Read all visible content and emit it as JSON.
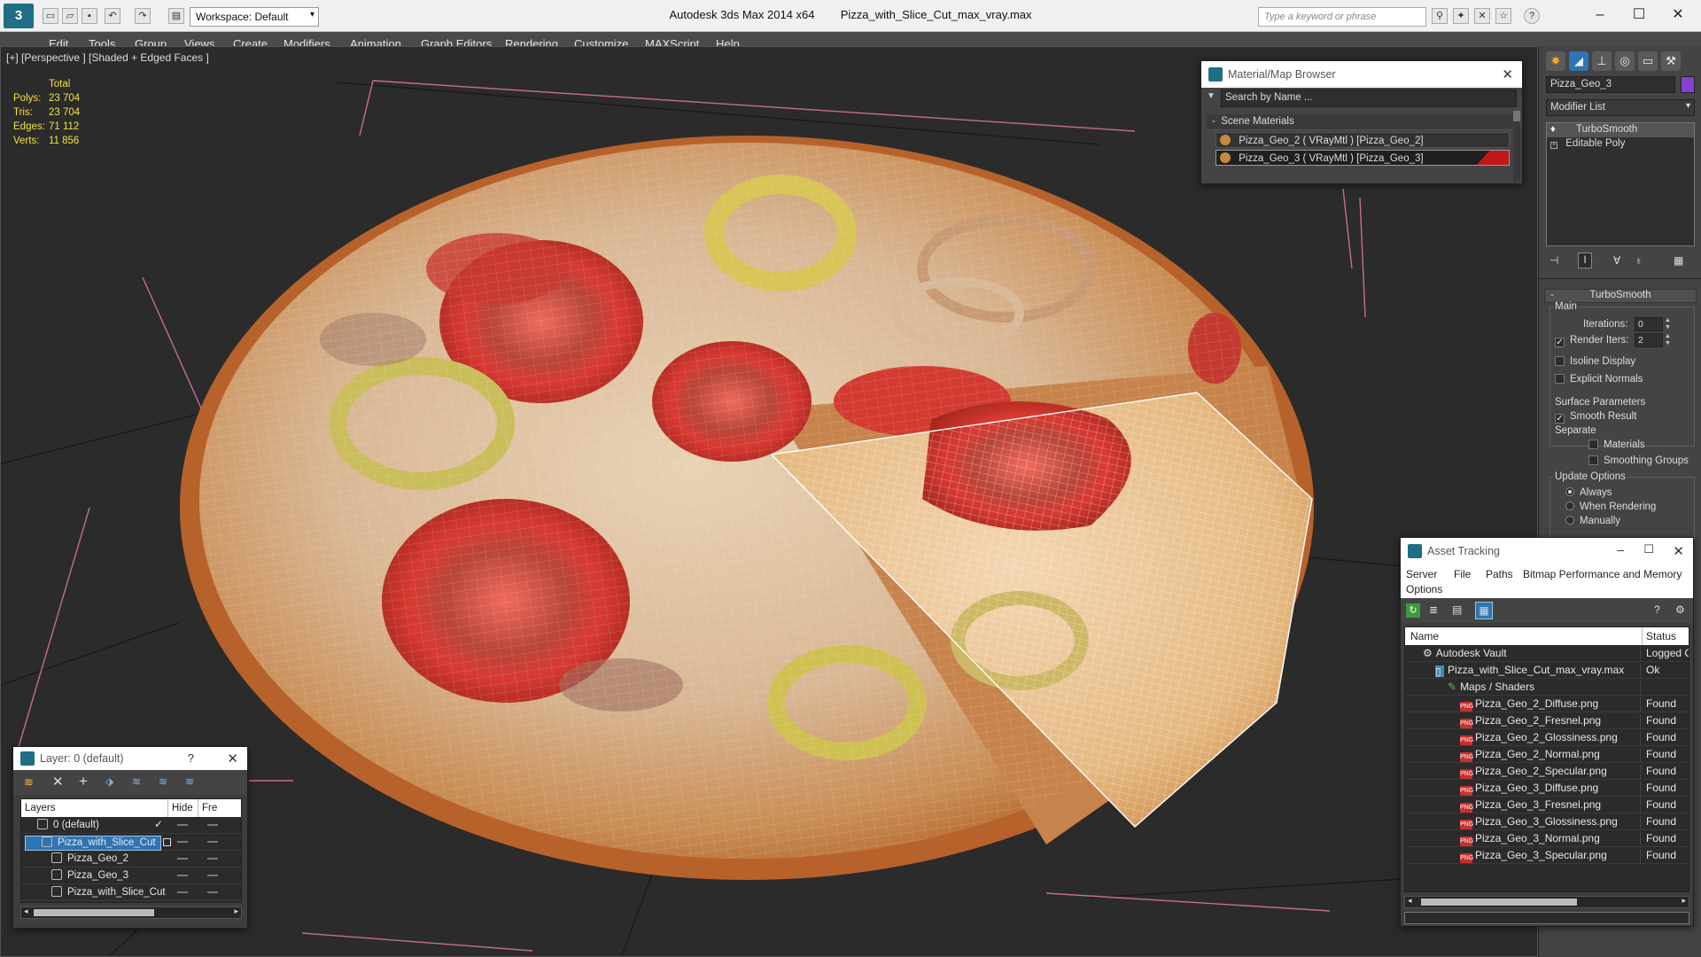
{
  "titlebar": {
    "app_title": "Autodesk 3ds Max  2014 x64",
    "file_title": "Pizza_with_Slice_Cut_max_vray.max",
    "workspace": "Workspace: Default",
    "search_placeholder": "Type a keyword or phrase"
  },
  "menu": [
    "Edit",
    "Tools",
    "Group",
    "Views",
    "Create",
    "Modifiers",
    "Animation",
    "Graph Editors",
    "Rendering",
    "Customize",
    "MAXScript",
    "Help"
  ],
  "viewport": {
    "label": "[+] [Perspective ] [Shaded + Edged Faces ]",
    "stats_header": "Total",
    "stats": [
      {
        "k": "Polys:",
        "v": "23 704"
      },
      {
        "k": "Tris:",
        "v": "23 704"
      },
      {
        "k": "Edges:",
        "v": "71 112"
      },
      {
        "k": "Verts:",
        "v": "11 856"
      }
    ]
  },
  "material_browser": {
    "title": "Material/Map Browser",
    "search_placeholder": "Search by Name ...",
    "section": "Scene Materials",
    "items": [
      {
        "label": "Pizza_Geo_2  ( VRayMtl )  [Pizza_Geo_2]",
        "color": "#3b3b3b"
      },
      {
        "label": "Pizza_Geo_3  ( VRayMtl )  [Pizza_Geo_3]",
        "color": "#c01818"
      }
    ]
  },
  "command_panel": {
    "object_name": "Pizza_Geo_3",
    "object_color": "#8a3fd0",
    "modifier_list": "Modifier List",
    "stack": [
      "TurboSmooth",
      "Editable Poly"
    ],
    "rollout_title": "TurboSmooth",
    "main_label": "Main",
    "iterations_label": "Iterations:",
    "iterations_value": "0",
    "render_iters_label": "Render Iters:",
    "render_iters_value": "2",
    "isoline": "Isoline Display",
    "explicit_normals": "Explicit Normals",
    "surface_params": "Surface Parameters",
    "smooth_result": "Smooth Result",
    "separate": "Separate",
    "materials": "Materials",
    "smoothing_groups": "Smoothing Groups",
    "update_options": "Update Options",
    "always": "Always",
    "when_rendering": "When Rendering",
    "manually": "Manually"
  },
  "layer_panel": {
    "title": "Layer: 0 (default)",
    "help": "?",
    "col_layers": "Layers",
    "col_hide": "Hide",
    "col_freeze": "Fre",
    "rows": [
      {
        "name": "0 (default)",
        "indent": 0
      },
      {
        "name": "Pizza_with_Slice_Cut",
        "indent": 0
      },
      {
        "name": "Pizza_Geo_2",
        "indent": 1
      },
      {
        "name": "Pizza_Geo_3",
        "indent": 1
      },
      {
        "name": "Pizza_with_Slice_Cut",
        "indent": 1
      }
    ]
  },
  "asset_tracking": {
    "title": "Asset Tracking",
    "menu": [
      "Server",
      "File",
      "Paths",
      "Bitmap Performance and Memory",
      "Options"
    ],
    "col_name": "Name",
    "col_status": "Status",
    "rows": [
      {
        "name": "Autodesk Vault",
        "status": "Logged C",
        "indent": 1,
        "type": "vault"
      },
      {
        "name": "Pizza_with_Slice_Cut_max_vray.max",
        "status": "Ok",
        "indent": 2,
        "type": "max"
      },
      {
        "name": "Maps / Shaders",
        "status": "",
        "indent": 3,
        "type": "maps"
      },
      {
        "name": "Pizza_Geo_2_Diffuse.png",
        "status": "Found",
        "indent": 4,
        "type": "png"
      },
      {
        "name": "Pizza_Geo_2_Fresnel.png",
        "status": "Found",
        "indent": 4,
        "type": "png"
      },
      {
        "name": "Pizza_Geo_2_Glossiness.png",
        "status": "Found",
        "indent": 4,
        "type": "png"
      },
      {
        "name": "Pizza_Geo_2_Normal.png",
        "status": "Found",
        "indent": 4,
        "type": "png"
      },
      {
        "name": "Pizza_Geo_2_Specular.png",
        "status": "Found",
        "indent": 4,
        "type": "png"
      },
      {
        "name": "Pizza_Geo_3_Diffuse.png",
        "status": "Found",
        "indent": 4,
        "type": "png"
      },
      {
        "name": "Pizza_Geo_3_Fresnel.png",
        "status": "Found",
        "indent": 4,
        "type": "png"
      },
      {
        "name": "Pizza_Geo_3_Glossiness.png",
        "status": "Found",
        "indent": 4,
        "type": "png"
      },
      {
        "name": "Pizza_Geo_3_Normal.png",
        "status": "Found",
        "indent": 4,
        "type": "png"
      },
      {
        "name": "Pizza_Geo_3_Specular.png",
        "status": "Found",
        "indent": 4,
        "type": "png"
      }
    ]
  }
}
